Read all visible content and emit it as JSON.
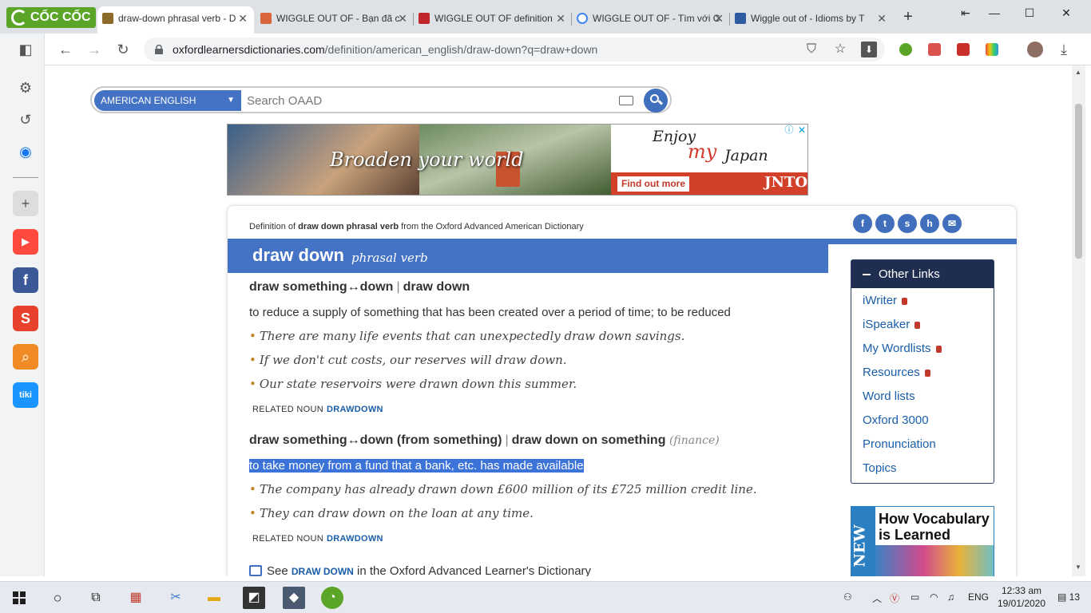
{
  "browser": {
    "logo_text": "CỐC CỐC",
    "tabs": [
      {
        "title": "draw-down phrasal verb - D",
        "active": true
      },
      {
        "title": "WIGGLE OUT OF - Bạn đã c"
      },
      {
        "title": "WIGGLE OUT OF definition"
      },
      {
        "title": "WIGGLE OUT OF - Tìm với C"
      },
      {
        "title": "Wiggle out of - Idioms by T"
      }
    ],
    "new_tab": "+",
    "url_domain": "oxfordlearnersdictionaries.com",
    "url_path": "/definition/american_english/draw-down?q=draw+down"
  },
  "site": {
    "dialect_label": "AMERICAN ENGLISH",
    "search_placeholder": "Search OAAD"
  },
  "ad": {
    "headline": "Broaden your world",
    "enjoy": "Enjoy",
    "my": "my",
    "japan": "Japan",
    "cta": "Find out more",
    "brand": "JNTO"
  },
  "entry": {
    "def_prefix": "Definition of ",
    "def_bold": "draw down phrasal verb",
    "def_suffix": " from the Oxford Advanced American Dictionary",
    "headword": "draw down",
    "pos": "phrasal verb",
    "senses": [
      {
        "cf1": "draw something↔down",
        "cf2": "draw down",
        "definition": "to reduce a supply of something that has been created over a period of time; to be reduced",
        "examples": [
          "There are many life events that can unexpectedly draw down savings.",
          "If we don't cut costs, our reserves will draw down.",
          "Our state reservoirs were drawn down this summer."
        ],
        "related_label": "RELATED NOUN",
        "related_link": "DRAWDOWN"
      },
      {
        "cf1": "draw something↔down (from something)",
        "cf2": "draw down on something",
        "label": "(finance)",
        "definition": "to take money from a fund that a bank, etc. has made available",
        "examples": [
          "The company has already drawn down £600 million of its £725 million credit line.",
          "They can draw down on the loan at any time."
        ],
        "related_label": "RELATED NOUN",
        "related_link": "DRAWDOWN"
      }
    ],
    "see_prefix": "See ",
    "see_link": "DRAW DOWN",
    "see_suffix": " in the Oxford Advanced Learner's Dictionary"
  },
  "other_links": {
    "title": "Other Links",
    "items": [
      {
        "label": "iWriter",
        "locked": true
      },
      {
        "label": "iSpeaker",
        "locked": true
      },
      {
        "label": "My Wordlists",
        "locked": true
      },
      {
        "label": "Resources",
        "locked": true
      },
      {
        "label": "Word lists",
        "locked": false
      },
      {
        "label": "Oxford 3000",
        "locked": false
      },
      {
        "label": "Pronunciation",
        "locked": false
      },
      {
        "label": "Topics",
        "locked": false
      }
    ]
  },
  "book_ad": {
    "badge": "NEW",
    "title_line1": "How Vocabulary",
    "title_line2": "is Learned"
  },
  "taskbar": {
    "language": "ENG",
    "time": "12:33 am",
    "date": "19/01/2020",
    "notifications": "13"
  },
  "colors": {
    "oxford_blue": "#4472c4",
    "dark_navy": "#1f2e50",
    "link_blue": "#1a5ea8",
    "highlight": "#3b73d9",
    "coccoc_green": "#5aa428"
  }
}
